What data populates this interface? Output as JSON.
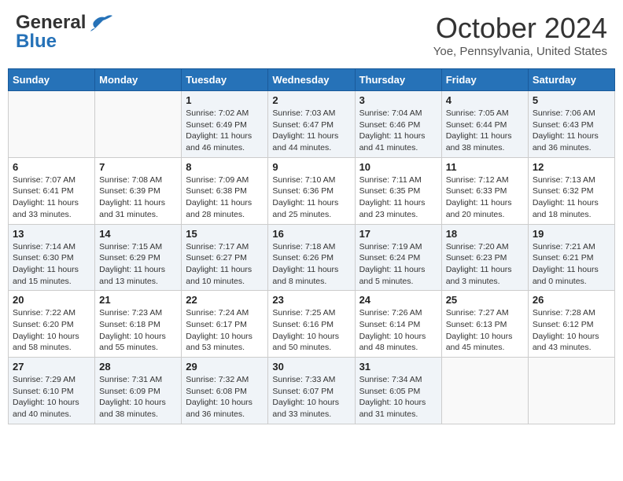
{
  "header": {
    "logo_line1": "General",
    "logo_line2": "Blue",
    "month_title": "October 2024",
    "location": "Yoe, Pennsylvania, United States"
  },
  "weekdays": [
    "Sunday",
    "Monday",
    "Tuesday",
    "Wednesday",
    "Thursday",
    "Friday",
    "Saturday"
  ],
  "weeks": [
    [
      {
        "day": "",
        "sunrise": "",
        "sunset": "",
        "daylight": ""
      },
      {
        "day": "",
        "sunrise": "",
        "sunset": "",
        "daylight": ""
      },
      {
        "day": "1",
        "sunrise": "Sunrise: 7:02 AM",
        "sunset": "Sunset: 6:49 PM",
        "daylight": "Daylight: 11 hours and 46 minutes."
      },
      {
        "day": "2",
        "sunrise": "Sunrise: 7:03 AM",
        "sunset": "Sunset: 6:47 PM",
        "daylight": "Daylight: 11 hours and 44 minutes."
      },
      {
        "day": "3",
        "sunrise": "Sunrise: 7:04 AM",
        "sunset": "Sunset: 6:46 PM",
        "daylight": "Daylight: 11 hours and 41 minutes."
      },
      {
        "day": "4",
        "sunrise": "Sunrise: 7:05 AM",
        "sunset": "Sunset: 6:44 PM",
        "daylight": "Daylight: 11 hours and 38 minutes."
      },
      {
        "day": "5",
        "sunrise": "Sunrise: 7:06 AM",
        "sunset": "Sunset: 6:43 PM",
        "daylight": "Daylight: 11 hours and 36 minutes."
      }
    ],
    [
      {
        "day": "6",
        "sunrise": "Sunrise: 7:07 AM",
        "sunset": "Sunset: 6:41 PM",
        "daylight": "Daylight: 11 hours and 33 minutes."
      },
      {
        "day": "7",
        "sunrise": "Sunrise: 7:08 AM",
        "sunset": "Sunset: 6:39 PM",
        "daylight": "Daylight: 11 hours and 31 minutes."
      },
      {
        "day": "8",
        "sunrise": "Sunrise: 7:09 AM",
        "sunset": "Sunset: 6:38 PM",
        "daylight": "Daylight: 11 hours and 28 minutes."
      },
      {
        "day": "9",
        "sunrise": "Sunrise: 7:10 AM",
        "sunset": "Sunset: 6:36 PM",
        "daylight": "Daylight: 11 hours and 25 minutes."
      },
      {
        "day": "10",
        "sunrise": "Sunrise: 7:11 AM",
        "sunset": "Sunset: 6:35 PM",
        "daylight": "Daylight: 11 hours and 23 minutes."
      },
      {
        "day": "11",
        "sunrise": "Sunrise: 7:12 AM",
        "sunset": "Sunset: 6:33 PM",
        "daylight": "Daylight: 11 hours and 20 minutes."
      },
      {
        "day": "12",
        "sunrise": "Sunrise: 7:13 AM",
        "sunset": "Sunset: 6:32 PM",
        "daylight": "Daylight: 11 hours and 18 minutes."
      }
    ],
    [
      {
        "day": "13",
        "sunrise": "Sunrise: 7:14 AM",
        "sunset": "Sunset: 6:30 PM",
        "daylight": "Daylight: 11 hours and 15 minutes."
      },
      {
        "day": "14",
        "sunrise": "Sunrise: 7:15 AM",
        "sunset": "Sunset: 6:29 PM",
        "daylight": "Daylight: 11 hours and 13 minutes."
      },
      {
        "day": "15",
        "sunrise": "Sunrise: 7:17 AM",
        "sunset": "Sunset: 6:27 PM",
        "daylight": "Daylight: 11 hours and 10 minutes."
      },
      {
        "day": "16",
        "sunrise": "Sunrise: 7:18 AM",
        "sunset": "Sunset: 6:26 PM",
        "daylight": "Daylight: 11 hours and 8 minutes."
      },
      {
        "day": "17",
        "sunrise": "Sunrise: 7:19 AM",
        "sunset": "Sunset: 6:24 PM",
        "daylight": "Daylight: 11 hours and 5 minutes."
      },
      {
        "day": "18",
        "sunrise": "Sunrise: 7:20 AM",
        "sunset": "Sunset: 6:23 PM",
        "daylight": "Daylight: 11 hours and 3 minutes."
      },
      {
        "day": "19",
        "sunrise": "Sunrise: 7:21 AM",
        "sunset": "Sunset: 6:21 PM",
        "daylight": "Daylight: 11 hours and 0 minutes."
      }
    ],
    [
      {
        "day": "20",
        "sunrise": "Sunrise: 7:22 AM",
        "sunset": "Sunset: 6:20 PM",
        "daylight": "Daylight: 10 hours and 58 minutes."
      },
      {
        "day": "21",
        "sunrise": "Sunrise: 7:23 AM",
        "sunset": "Sunset: 6:18 PM",
        "daylight": "Daylight: 10 hours and 55 minutes."
      },
      {
        "day": "22",
        "sunrise": "Sunrise: 7:24 AM",
        "sunset": "Sunset: 6:17 PM",
        "daylight": "Daylight: 10 hours and 53 minutes."
      },
      {
        "day": "23",
        "sunrise": "Sunrise: 7:25 AM",
        "sunset": "Sunset: 6:16 PM",
        "daylight": "Daylight: 10 hours and 50 minutes."
      },
      {
        "day": "24",
        "sunrise": "Sunrise: 7:26 AM",
        "sunset": "Sunset: 6:14 PM",
        "daylight": "Daylight: 10 hours and 48 minutes."
      },
      {
        "day": "25",
        "sunrise": "Sunrise: 7:27 AM",
        "sunset": "Sunset: 6:13 PM",
        "daylight": "Daylight: 10 hours and 45 minutes."
      },
      {
        "day": "26",
        "sunrise": "Sunrise: 7:28 AM",
        "sunset": "Sunset: 6:12 PM",
        "daylight": "Daylight: 10 hours and 43 minutes."
      }
    ],
    [
      {
        "day": "27",
        "sunrise": "Sunrise: 7:29 AM",
        "sunset": "Sunset: 6:10 PM",
        "daylight": "Daylight: 10 hours and 40 minutes."
      },
      {
        "day": "28",
        "sunrise": "Sunrise: 7:31 AM",
        "sunset": "Sunset: 6:09 PM",
        "daylight": "Daylight: 10 hours and 38 minutes."
      },
      {
        "day": "29",
        "sunrise": "Sunrise: 7:32 AM",
        "sunset": "Sunset: 6:08 PM",
        "daylight": "Daylight: 10 hours and 36 minutes."
      },
      {
        "day": "30",
        "sunrise": "Sunrise: 7:33 AM",
        "sunset": "Sunset: 6:07 PM",
        "daylight": "Daylight: 10 hours and 33 minutes."
      },
      {
        "day": "31",
        "sunrise": "Sunrise: 7:34 AM",
        "sunset": "Sunset: 6:05 PM",
        "daylight": "Daylight: 10 hours and 31 minutes."
      },
      {
        "day": "",
        "sunrise": "",
        "sunset": "",
        "daylight": ""
      },
      {
        "day": "",
        "sunrise": "",
        "sunset": "",
        "daylight": ""
      }
    ]
  ]
}
